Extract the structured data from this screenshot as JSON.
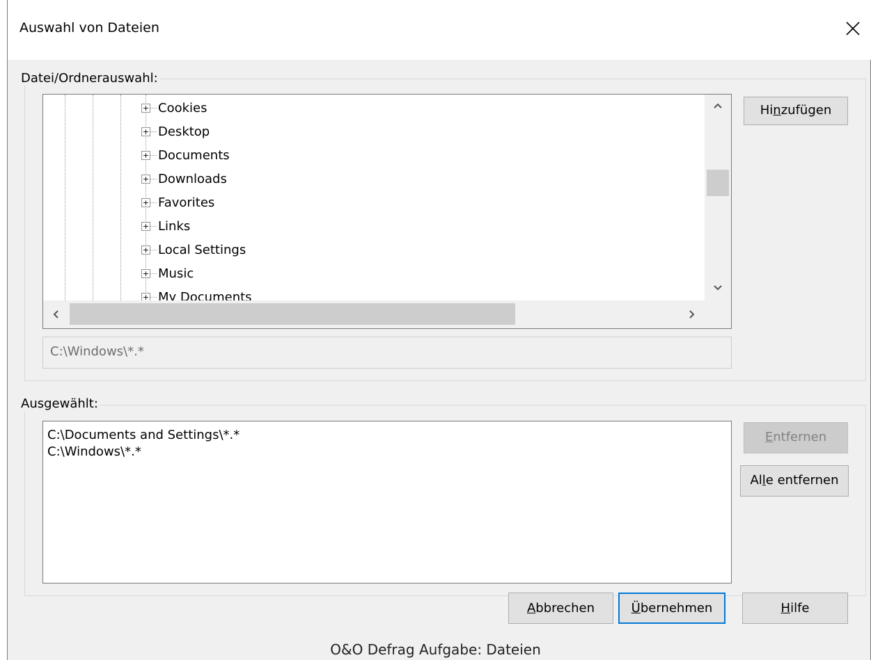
{
  "dialog": {
    "title": "Auswahl von Dateien",
    "close_icon": "close-icon"
  },
  "source_group": {
    "legend": "Datei/Ordnerauswahl:",
    "tree_items": [
      {
        "label": "Cookies"
      },
      {
        "label": "Desktop"
      },
      {
        "label": "Documents"
      },
      {
        "label": "Downloads"
      },
      {
        "label": "Favorites"
      },
      {
        "label": "Links"
      },
      {
        "label": "Local Settings"
      },
      {
        "label": "Music"
      },
      {
        "label": "My Documents"
      }
    ],
    "path_value": "C:\\Windows\\*.*",
    "add_button": {
      "pre": "Hi",
      "key": "n",
      "post": "zufügen"
    }
  },
  "selected_group": {
    "legend": "Ausgewählt:",
    "items": [
      "C:\\Documents and Settings\\*.*",
      "C:\\Windows\\*.*"
    ],
    "remove_button": {
      "pre": "",
      "key": "E",
      "post": "ntfernen",
      "enabled": false
    },
    "remove_all_button": {
      "pre": "Al",
      "key": "l",
      "post": "e entfernen"
    }
  },
  "footer": {
    "cancel_button": {
      "pre": "",
      "key": "A",
      "post": "bbrechen"
    },
    "apply_button": {
      "pre": "",
      "key": "Ü",
      "post": "bernehmen"
    },
    "help_button": {
      "pre": "",
      "key": "H",
      "post": "ilfe"
    }
  },
  "caption": "O&O Defrag Aufgabe: Dateien",
  "colors": {
    "dialog_bg": "#f0f0f0",
    "accent": "#0078d7"
  }
}
